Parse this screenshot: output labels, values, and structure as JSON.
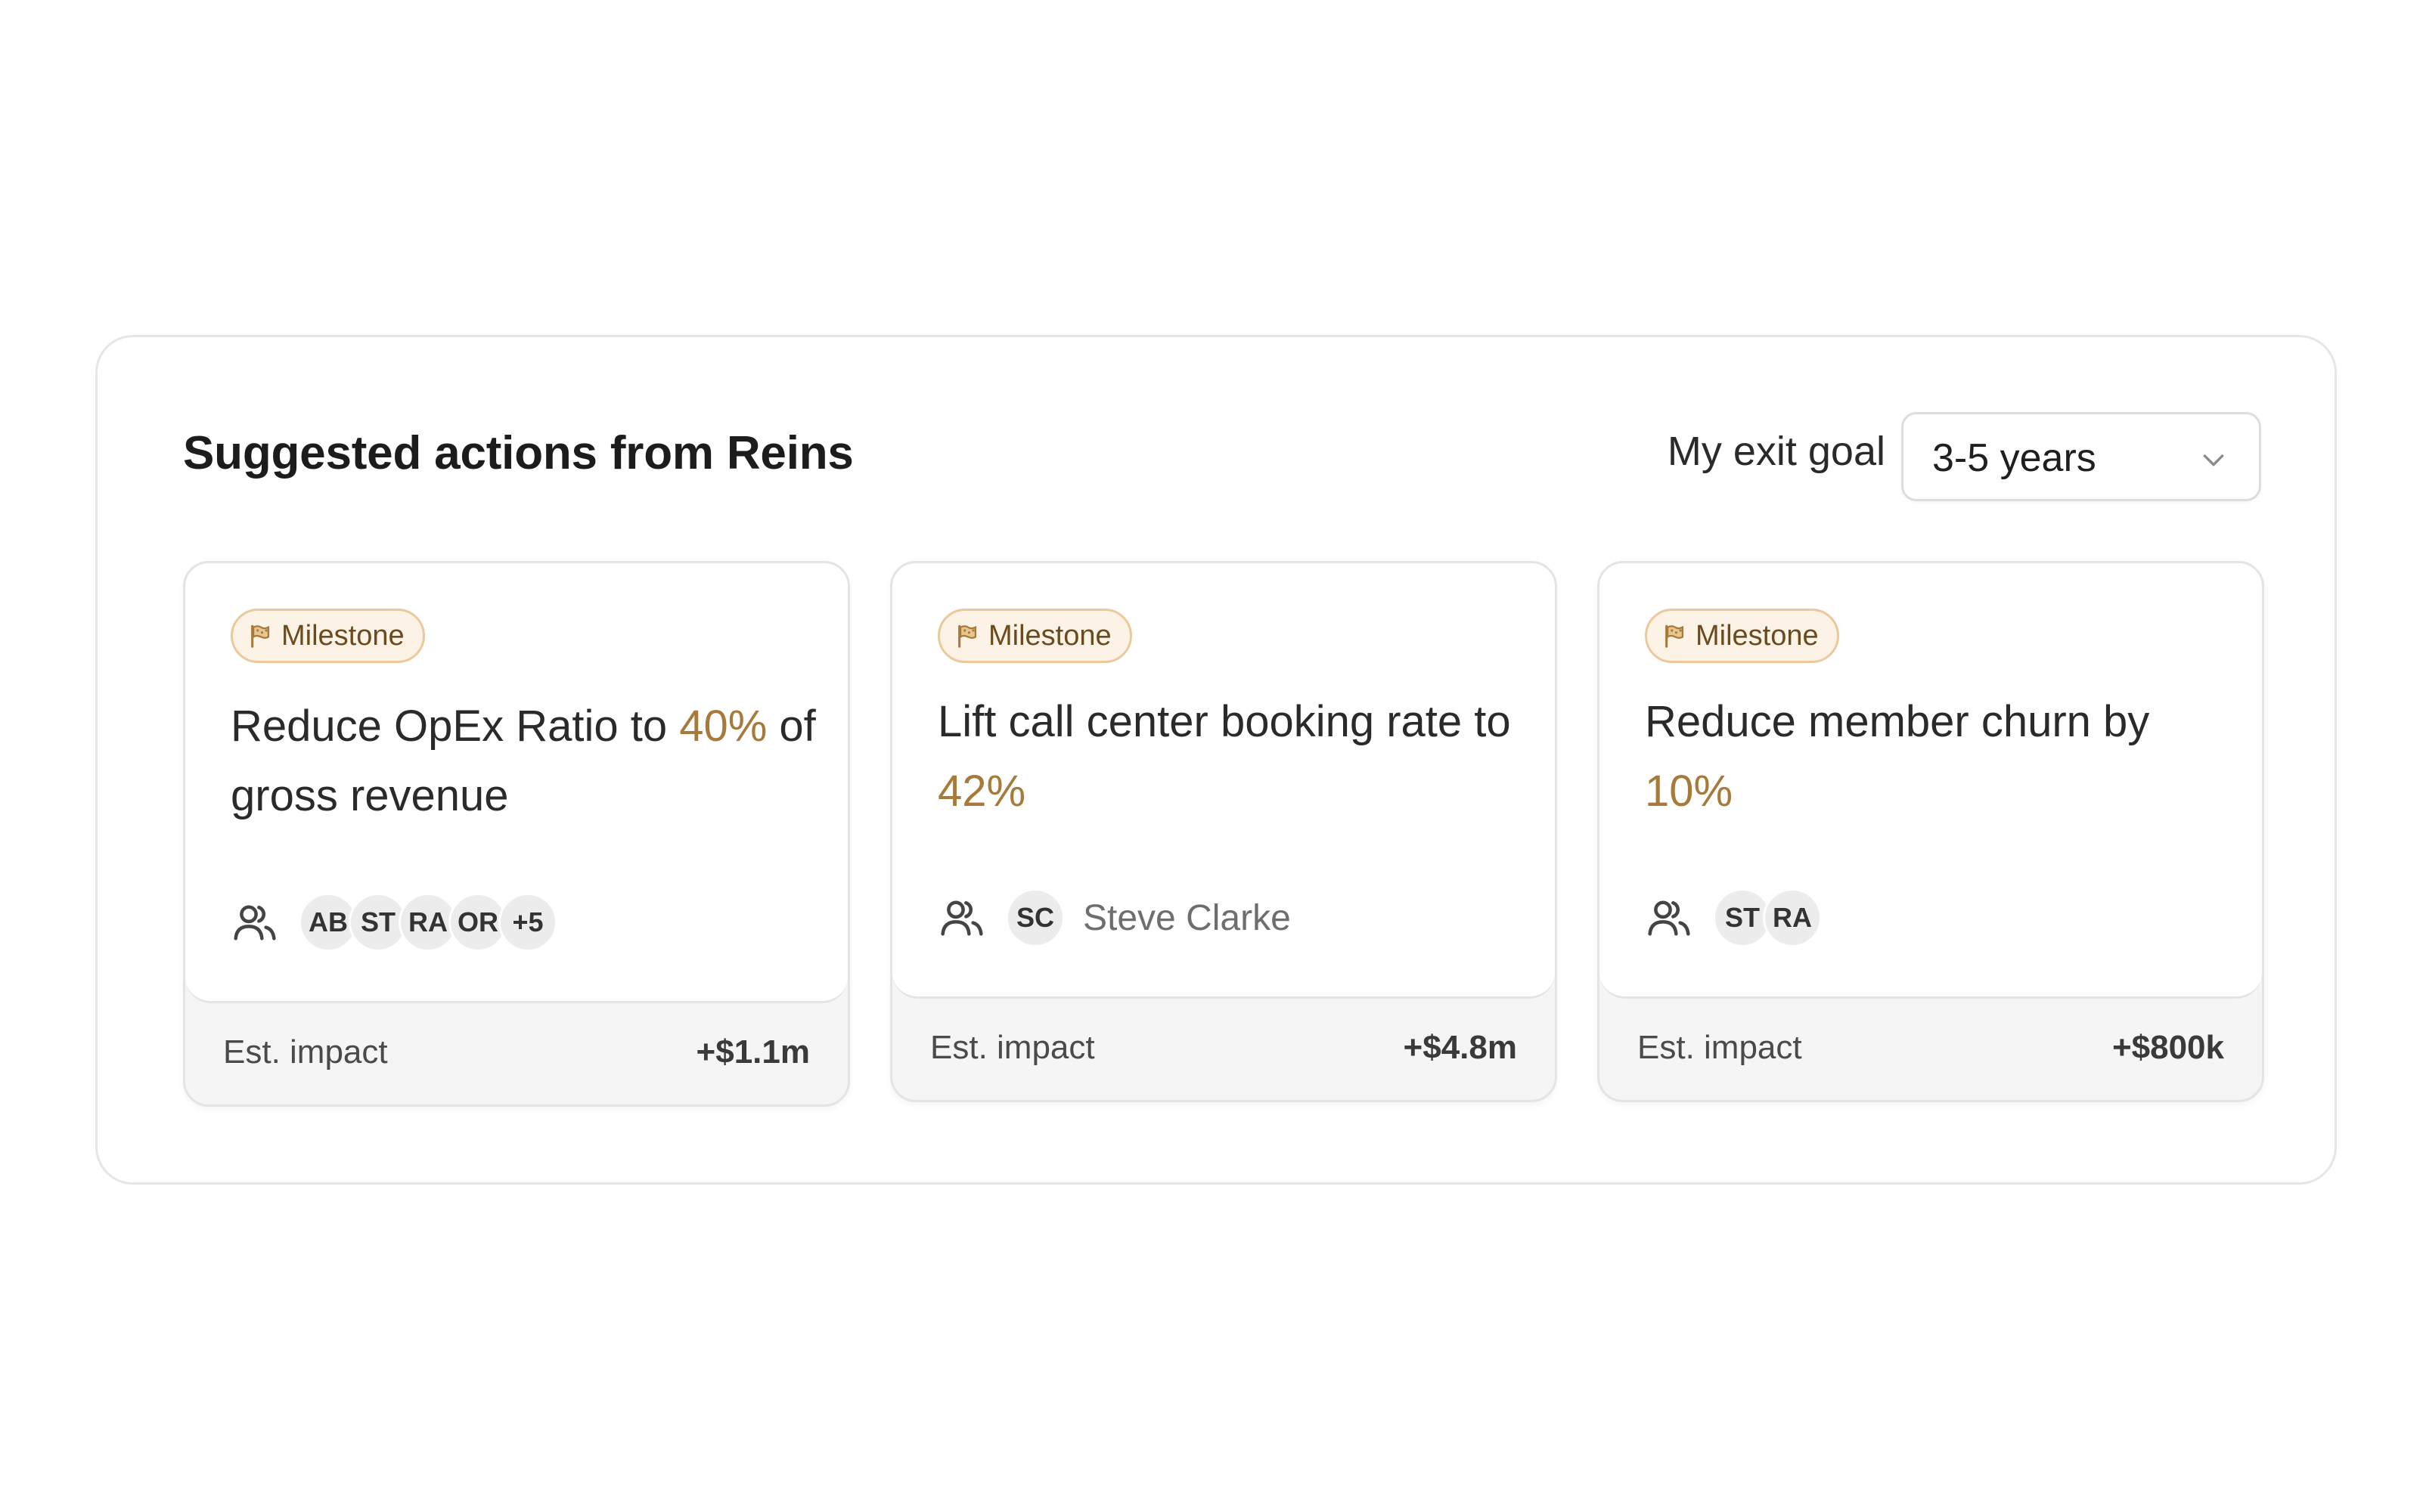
{
  "panel": {
    "title": "Suggested actions from Reins",
    "exit_goal_label": "My exit goal",
    "exit_goal_value": "3-5 years"
  },
  "colors": {
    "accent": "#a67a3a",
    "badge_bg": "#fcf3e6",
    "badge_border": "#ebc99a",
    "card_footer_bg": "#f5f5f5"
  },
  "cards": [
    {
      "badge": "Milestone",
      "title_before": "Reduce OpEx Ratio to ",
      "title_accent": "40%",
      "title_after": " of gross revenue",
      "avatars": [
        "AB",
        "ST",
        "RA",
        "OR",
        "+5"
      ],
      "assignee_name": "",
      "impact_label": "Est. impact",
      "impact_value": "+$1.1m"
    },
    {
      "badge": "Milestone",
      "title_before": "Lift call center booking rate to ",
      "title_accent": "42%",
      "title_after": "",
      "avatars": [
        "SC"
      ],
      "assignee_name": "Steve Clarke",
      "impact_label": "Est. impact",
      "impact_value": "+$4.8m"
    },
    {
      "badge": "Milestone",
      "title_before": "Reduce member churn by ",
      "title_accent": "10%",
      "title_after": "",
      "avatars": [
        "ST",
        "RA"
      ],
      "assignee_name": "",
      "impact_label": "Est. impact",
      "impact_value": "+$800k"
    }
  ]
}
